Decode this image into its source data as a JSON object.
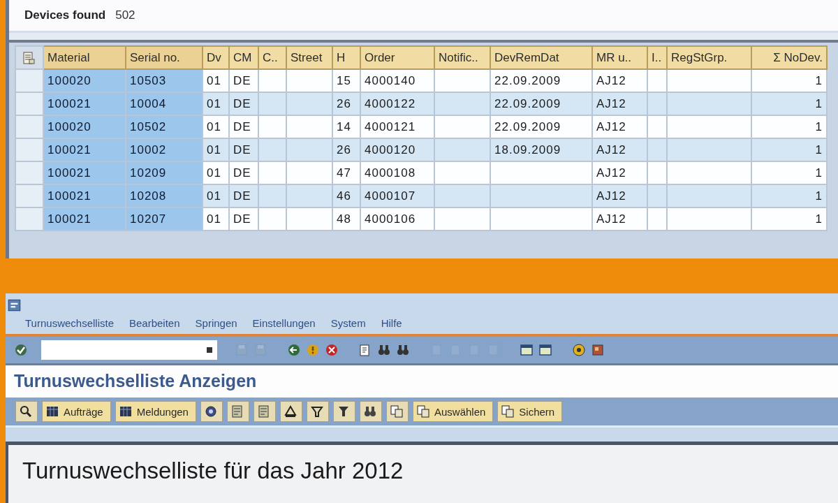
{
  "result_header": {
    "label": "Devices found",
    "value": "502"
  },
  "table": {
    "columns": [
      {
        "label": "Material",
        "selected": true
      },
      {
        "label": "Serial no.",
        "selected": true
      },
      {
        "label": "Dv",
        "selected": false
      },
      {
        "label": "CM",
        "selected": false
      },
      {
        "label": "C..",
        "selected": false
      },
      {
        "label": "Street",
        "selected": false
      },
      {
        "label": "H",
        "selected": false
      },
      {
        "label": "Order",
        "selected": false
      },
      {
        "label": "Notific..",
        "selected": false
      },
      {
        "label": "DevRemDat",
        "selected": false
      },
      {
        "label": "MR u..",
        "selected": false
      },
      {
        "label": "I..",
        "selected": false
      },
      {
        "label": "RegStGrp.",
        "selected": false
      },
      {
        "label": "Σ NoDev.",
        "selected": false,
        "numeric": true
      }
    ],
    "rows": [
      [
        "100020",
        "10503",
        "01",
        "DE",
        "",
        "",
        "15",
        "4000140",
        "",
        "22.09.2009",
        "AJ12",
        "",
        "",
        "1"
      ],
      [
        "100021",
        "10004",
        "01",
        "DE",
        "",
        "",
        "26",
        "4000122",
        "",
        "22.09.2009",
        "AJ12",
        "",
        "",
        "1"
      ],
      [
        "100020",
        "10502",
        "01",
        "DE",
        "",
        "",
        "14",
        "4000121",
        "",
        "22.09.2009",
        "AJ12",
        "",
        "",
        "1"
      ],
      [
        "100021",
        "10002",
        "01",
        "DE",
        "",
        "",
        "26",
        "4000120",
        "",
        "18.09.2009",
        "AJ12",
        "",
        "",
        "1"
      ],
      [
        "100021",
        "10209",
        "01",
        "DE",
        "",
        "",
        "47",
        "4000108",
        "",
        "",
        "AJ12",
        "",
        "",
        "1"
      ],
      [
        "100021",
        "10208",
        "01",
        "DE",
        "",
        "",
        "46",
        "4000107",
        "",
        "",
        "AJ12",
        "",
        "",
        "1"
      ],
      [
        "100021",
        "10207",
        "01",
        "DE",
        "",
        "",
        "48",
        "4000106",
        "",
        "",
        "AJ12",
        "",
        "",
        "1"
      ]
    ]
  },
  "menu_bar": [
    "Turnuswechselliste",
    "Bearbeiten",
    "Springen",
    "Einstellungen",
    "System",
    "Hilfe"
  ],
  "system_toolbar": [
    {
      "kind": "enter",
      "disabled": false
    },
    {
      "kind": "command_field"
    },
    {
      "kind": "save",
      "disabled": true
    },
    {
      "kind": "save",
      "disabled": true
    },
    {
      "kind": "back",
      "disabled": false
    },
    {
      "kind": "exit",
      "disabled": false
    },
    {
      "kind": "cancel",
      "disabled": false
    },
    {
      "kind": "print",
      "disabled": false
    },
    {
      "kind": "find",
      "disabled": false
    },
    {
      "kind": "find",
      "disabled": false
    },
    {
      "kind": "page",
      "disabled": true
    },
    {
      "kind": "page",
      "disabled": true
    },
    {
      "kind": "page",
      "disabled": true
    },
    {
      "kind": "page",
      "disabled": true
    },
    {
      "kind": "window",
      "disabled": false
    },
    {
      "kind": "window",
      "disabled": false
    },
    {
      "kind": "help",
      "disabled": false
    },
    {
      "kind": "layout",
      "disabled": false
    }
  ],
  "screen_title": "Turnuswechselliste Anzeigen",
  "application_toolbar": [
    {
      "kind": "search"
    },
    {
      "kind": "grid",
      "label": "Aufträge"
    },
    {
      "kind": "grid",
      "label": "Meldungen"
    },
    {
      "kind": "refresh"
    },
    {
      "kind": "sheet"
    },
    {
      "kind": "sheet"
    },
    {
      "kind": "sort_up"
    },
    {
      "kind": "sort_down"
    },
    {
      "kind": "filter"
    },
    {
      "kind": "binoculars"
    },
    {
      "kind": "variant"
    },
    {
      "kind": "variant",
      "label": "Auswählen"
    },
    {
      "kind": "variant",
      "label": "Sichern"
    }
  ],
  "report_heading": "Turnuswechselliste für das Jahr 2012"
}
